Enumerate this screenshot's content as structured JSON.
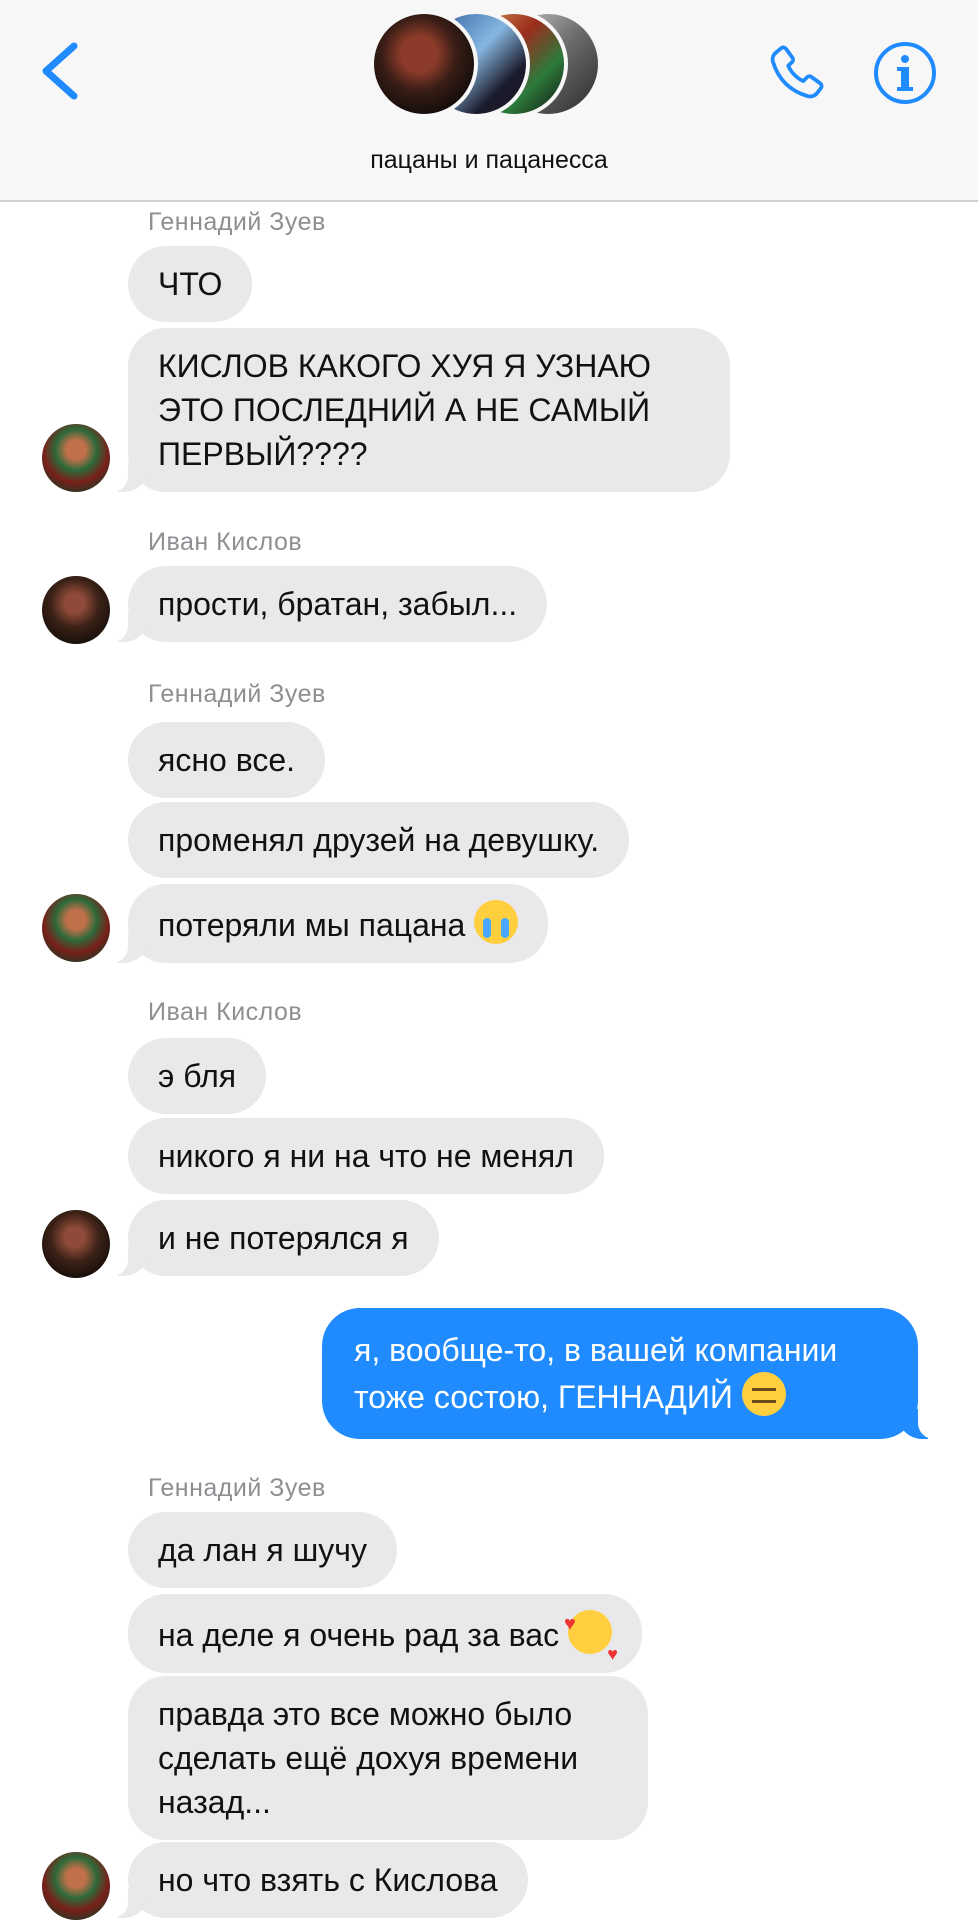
{
  "header": {
    "title": "пацаны и пацанесса",
    "back_icon": "chevron-left-icon",
    "call_icon": "phone-icon",
    "info_icon": "info-icon",
    "accent_color": "#1f8bff"
  },
  "messages": [
    {
      "sender": "Геннадий Зуев",
      "texts": [
        "ЧТО",
        "КИСЛОВ КАКОГО ХУЯ Я УЗНАЮ ЭТО ПОСЛЕДНИЙ А НЕ САМЫЙ ПЕРВЫЙ????"
      ]
    },
    {
      "sender": "Иван Кислов",
      "texts": [
        "прости, братан, забыл..."
      ]
    },
    {
      "sender": "Геннадий Зуев",
      "texts": [
        "ясно все.",
        "променял друзей на девушку.",
        "потеряли мы пацана"
      ]
    },
    {
      "sender": "Иван Кислов",
      "texts": [
        "э бля",
        "никого я ни на что не менял",
        "и не потерялся я"
      ]
    },
    {
      "sender": "Геннадий Зуев",
      "texts": [
        "да лан я шучу",
        "на деле я очень рад за вас",
        "правда это все можно было сделать ещё дохуя времени назад...",
        "но что взять с Кислова"
      ]
    }
  ],
  "outgoing": {
    "text": "я, вообще-то, в вашей компании тоже состою, ГЕННАДИЙ"
  },
  "emojis": {
    "crying": "loudly-crying-face-emoji",
    "expressionless": "expressionless-face-emoji",
    "hearts": "smiling-face-with-hearts-emoji"
  },
  "colors": {
    "incoming_bubble": "#e9e9eb",
    "outgoing_bubble": "#1f8bff",
    "sender_name": "#8e8e93"
  }
}
